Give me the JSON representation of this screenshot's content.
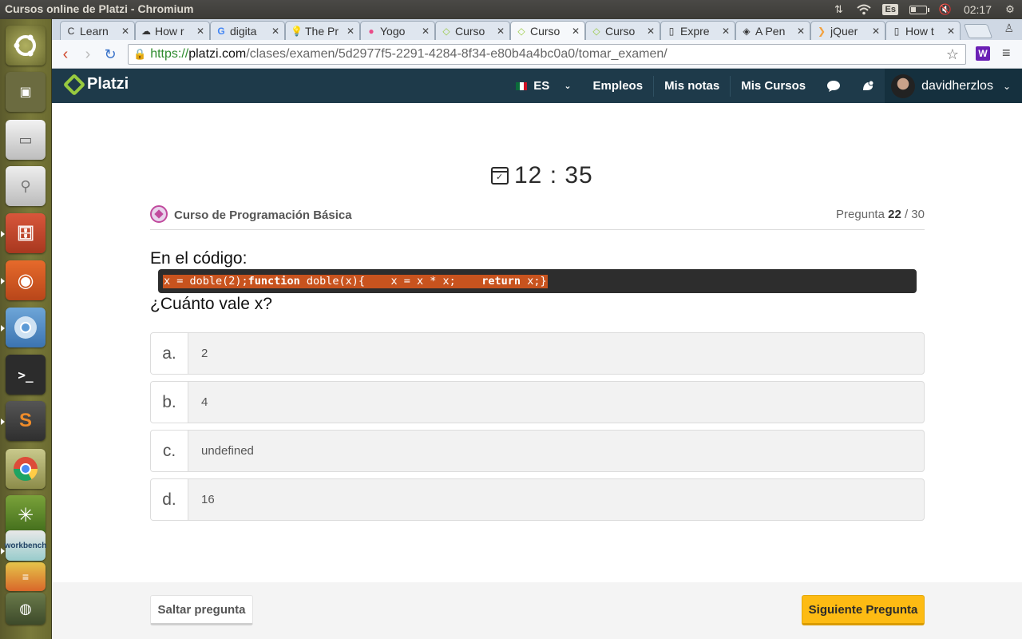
{
  "os": {
    "window_title": "Cursos online de Platzi - Chromium",
    "keyboard_layout": "Es",
    "clock": "02:17"
  },
  "launcher": {
    "items": [
      "ubuntu-dash",
      "workspace-switcher",
      "drive",
      "usb-drive",
      "file-manager",
      "firefox",
      "chromium",
      "terminal",
      "sublime-text",
      "chrome",
      "app-green",
      "mysql-workbench",
      "app-stack",
      "disk-app"
    ]
  },
  "browser": {
    "tabs": [
      {
        "label": "Learn",
        "favicon": "C"
      },
      {
        "label": "How r",
        "favicon": "☁"
      },
      {
        "label": "digita",
        "favicon": "G"
      },
      {
        "label": "The Pr",
        "favicon": "💡"
      },
      {
        "label": "Yogo",
        "favicon": "●"
      },
      {
        "label": "Curso",
        "favicon": "◇"
      },
      {
        "label": "Curso",
        "favicon": "◇"
      },
      {
        "label": "Curso",
        "favicon": "◇"
      },
      {
        "label": "Expre",
        "favicon": "▯"
      },
      {
        "label": "A Pen",
        "favicon": "◈"
      },
      {
        "label": "jQuer",
        "favicon": "❯"
      },
      {
        "label": "How t",
        "favicon": "▯"
      }
    ],
    "active_tab_index": 6,
    "url": {
      "scheme": "https://",
      "host": "platzi.com",
      "path": "/clases/examen/5d2977f5-2291-4284-8f34-e80b4a4bc0a0/tomar_examen/"
    },
    "extension_badge": "W"
  },
  "header": {
    "logo": "Platzi",
    "language": "ES",
    "nav": [
      "Empleos",
      "Mis notas",
      "Mis Cursos"
    ],
    "username": "davidherzlos"
  },
  "exam": {
    "timer": "12 : 35",
    "course_name": "Curso de Programación Básica",
    "question_label": "Pregunta",
    "question_current": "22",
    "question_total": "/ 30",
    "intro": "En el código:",
    "code": {
      "p1": "x = doble(2);",
      "kw1": "function",
      "p2": " doble(x){    x = x * x;    ",
      "kw2": "return",
      "p3": " x;}"
    },
    "question": "¿Cuánto vale x?",
    "options": [
      {
        "letter": "a.",
        "text": "2"
      },
      {
        "letter": "b.",
        "text": "4"
      },
      {
        "letter": "c.",
        "text": "undefined"
      },
      {
        "letter": "d.",
        "text": "16"
      }
    ],
    "skip_label": "Saltar pregunta",
    "next_label": "Siguiente Pregunta"
  },
  "colors": {
    "header_bg": "#1e3a4a",
    "platzi_green": "#98ca3f",
    "code_highlight": "#c8531e",
    "next_button": "#fdbb13"
  }
}
